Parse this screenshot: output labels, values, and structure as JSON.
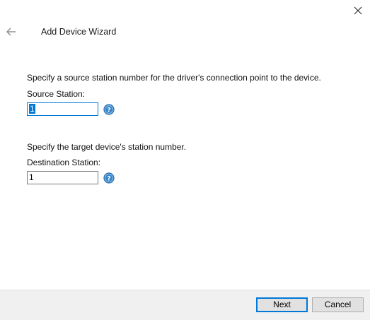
{
  "window": {
    "title": "Add Device Wizard"
  },
  "source": {
    "description": "Specify a source station number for the driver's connection point to the device.",
    "label": "Source Station:",
    "value": "1"
  },
  "destination": {
    "description": "Specify the target device's station number.",
    "label": "Destination Station:",
    "value": "1"
  },
  "buttons": {
    "next": "Next",
    "cancel": "Cancel"
  },
  "icons": {
    "close": "close-icon",
    "back": "back-arrow-icon",
    "help": "help-icon"
  },
  "colors": {
    "accent": "#0078d7",
    "help_icon": "#3a86c8",
    "footer_bg": "#f0f0f0"
  }
}
